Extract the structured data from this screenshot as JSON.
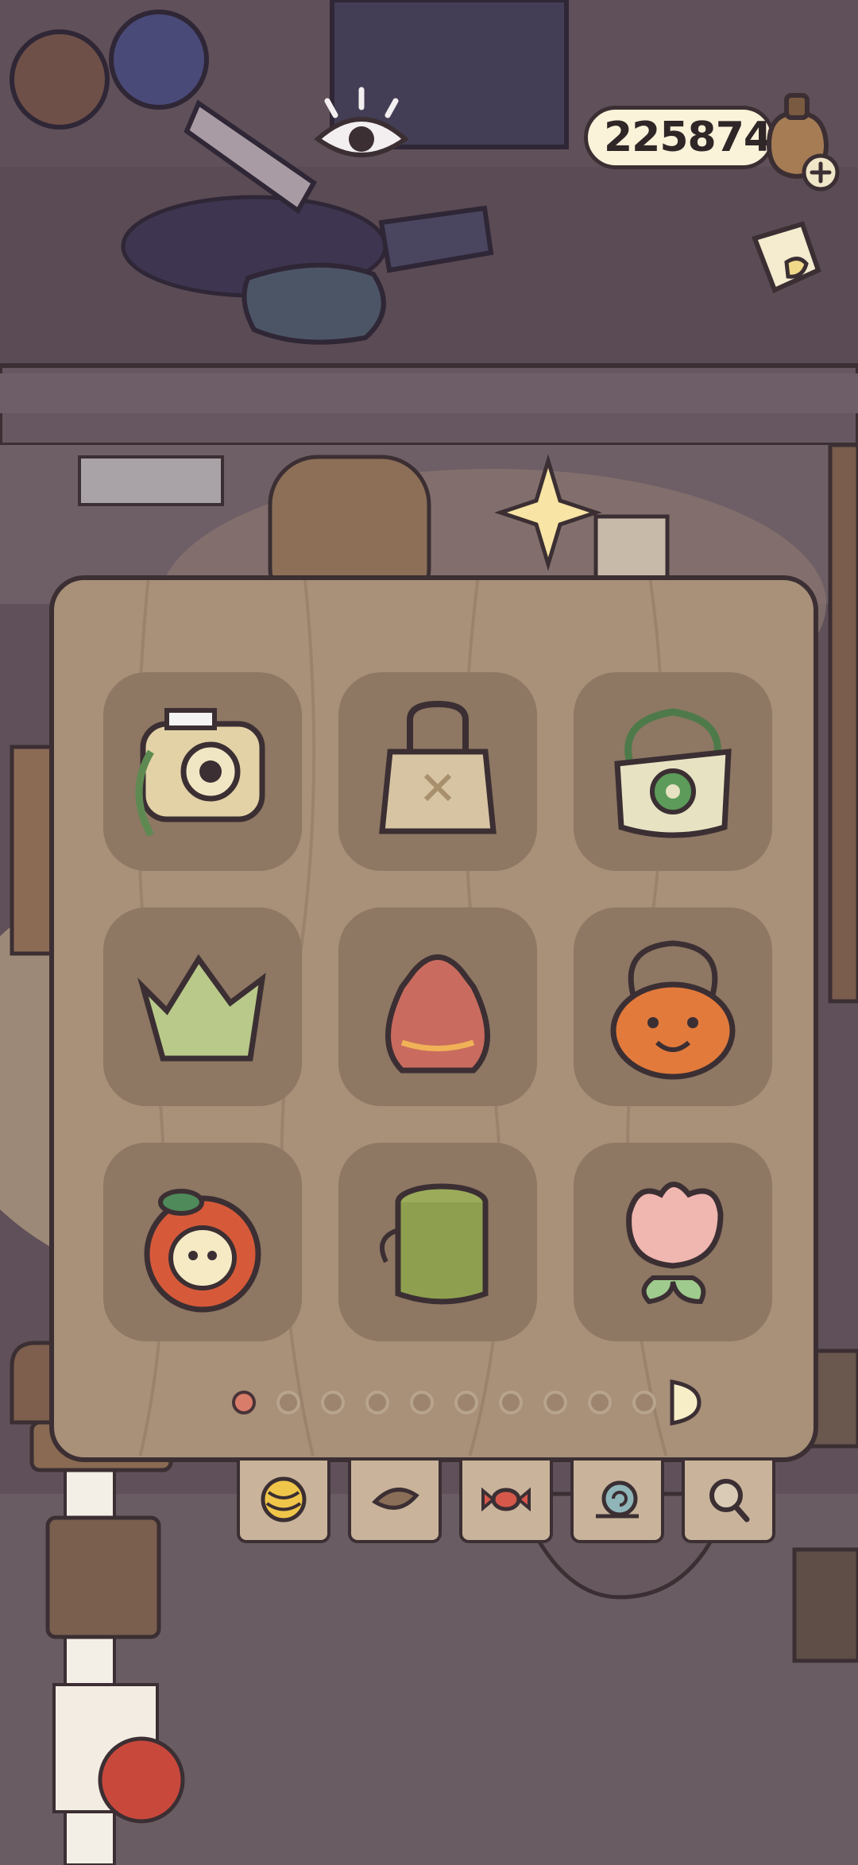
{
  "hud": {
    "coins": "225874",
    "coin_icon": "acorn-bag-icon",
    "add_icon": "plus-icon",
    "eye_icon": "eye-icon",
    "side_icon": "note-icon"
  },
  "inventory": {
    "items": [
      {
        "name": "instant-camera",
        "icon": "camera-icon"
      },
      {
        "name": "tote-bag",
        "icon": "tote-bag-icon"
      },
      {
        "name": "flower-bag",
        "icon": "flower-bag-icon"
      },
      {
        "name": "green-crown",
        "icon": "crown-icon"
      },
      {
        "name": "drawstring-pouch",
        "icon": "pouch-icon"
      },
      {
        "name": "pumpkin-bucket",
        "icon": "pumpkin-icon"
      },
      {
        "name": "apple-bag",
        "icon": "apple-icon"
      },
      {
        "name": "bamboo-bucket",
        "icon": "bucket-icon"
      },
      {
        "name": "tulip-bag",
        "icon": "tulip-icon"
      }
    ],
    "page_current": 1,
    "page_total": 10
  },
  "tabs": [
    {
      "name": "yarn",
      "icon": "yarn-icon"
    },
    {
      "name": "leaf",
      "icon": "leaf-icon"
    },
    {
      "name": "candy",
      "icon": "candy-icon"
    },
    {
      "name": "snail",
      "icon": "snail-icon"
    },
    {
      "name": "search",
      "icon": "magnifier-icon"
    }
  ],
  "colors": {
    "outline": "#3b2f33",
    "panel": "#a89079",
    "slot": "#8e7763",
    "page_active": "#d97d6a",
    "coin_pill": "#fbf3d9"
  }
}
